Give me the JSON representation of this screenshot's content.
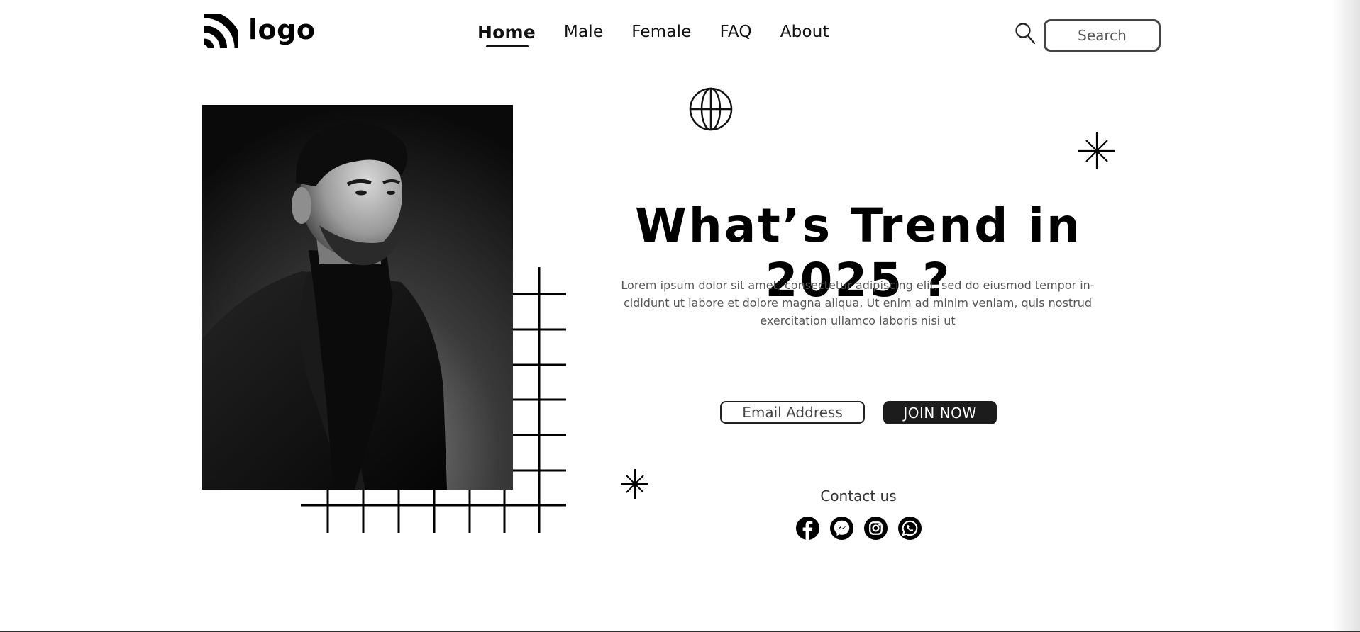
{
  "brand": {
    "logo_text": "logo"
  },
  "nav": {
    "items": [
      {
        "label": "Home",
        "active": true
      },
      {
        "label": "Male",
        "active": false
      },
      {
        "label": "Female",
        "active": false
      },
      {
        "label": "FAQ",
        "active": false
      },
      {
        "label": "About",
        "active": false
      }
    ]
  },
  "search": {
    "placeholder": "Search",
    "value": ""
  },
  "hero": {
    "headline": "What’s Trend in 2025 ?",
    "body": "Lorem ipsum dolor sit amet, consectetur adipiscing elit, sed do eiusmod tempor in-cididunt ut labore et dolore magna aliqua. Ut enim ad minim veniam, quis nostrud exercitation ullamco laboris nisi ut",
    "email_placeholder": "Email Address",
    "join_label": "JOIN NOW"
  },
  "contact": {
    "title": "Contact us",
    "socials": [
      "facebook-icon",
      "messenger-icon",
      "instagram-icon",
      "whatsapp-icon"
    ]
  },
  "colors": {
    "text": "#000000",
    "button_bg": "#1c1c1c",
    "body_text": "#555555",
    "background": "#ffffff"
  }
}
